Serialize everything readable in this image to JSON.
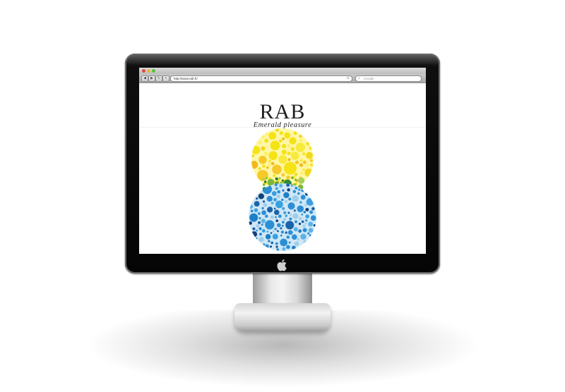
{
  "browser": {
    "url": "http://www.rab.fr/",
    "search_placeholder": "Google",
    "nav": {
      "back": "◀",
      "forward": "▶",
      "reload": "↻",
      "add": "+"
    }
  },
  "site": {
    "title": "RAB",
    "tagline": "Emerald pleasure"
  },
  "icons": {
    "brand_logo": "apple-logo-icon",
    "search": "search-icon",
    "reload": "reload-icon"
  },
  "colors": {
    "bezel": "#050505",
    "screen": "#ffffff",
    "yellow": "#f5e316",
    "orange": "#f1b81b",
    "green": "#7ab83d",
    "blue": "#2c8fd6",
    "light_blue": "#9fcde9",
    "navy": "#14407a"
  }
}
